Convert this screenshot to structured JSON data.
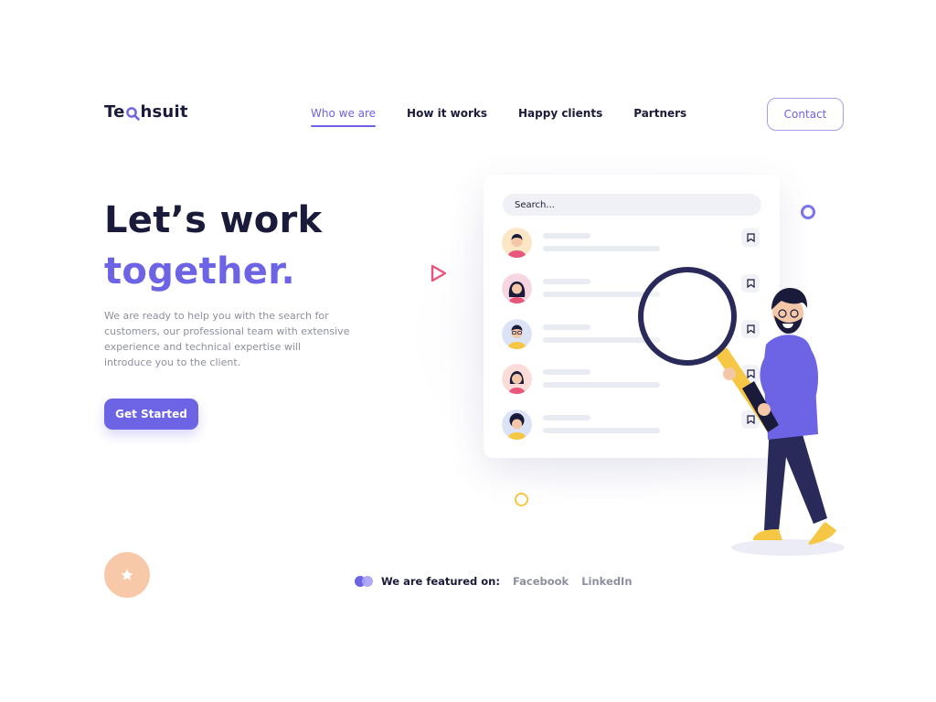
{
  "brand": {
    "logo_pre": "Te",
    "logo_post": "hsuit"
  },
  "nav": {
    "items": [
      {
        "label": "Who we are",
        "active": true
      },
      {
        "label": "How it works",
        "active": false
      },
      {
        "label": "Happy clients",
        "active": false
      },
      {
        "label": "Partners",
        "active": false
      }
    ],
    "contact_label": "Contact"
  },
  "hero": {
    "title_line1": "Let’s work",
    "title_line2": "together.",
    "description": "We are ready to help you with the search for customers, our professional team with extensive experience and technical expertise will introduce you to the client.",
    "cta_label": "Get Started"
  },
  "illustration": {
    "search_placeholder": "Search...",
    "rows": [
      {
        "avatar": "man-avatar-icon"
      },
      {
        "avatar": "woman-avatar-icon"
      },
      {
        "avatar": "man-glasses-avatar-icon"
      },
      {
        "avatar": "woman-red-avatar-icon"
      },
      {
        "avatar": "curly-hair-avatar-icon"
      }
    ]
  },
  "featured": {
    "label": "We are featured on:",
    "links": [
      "Facebook",
      "LinkedIn"
    ]
  },
  "colors": {
    "accent": "#6c63e5",
    "dark": "#1a1b3a",
    "muted": "#8d8f9e",
    "peach": "#f8c9a9",
    "yellow": "#f6c744",
    "pink": "#e8577b"
  }
}
